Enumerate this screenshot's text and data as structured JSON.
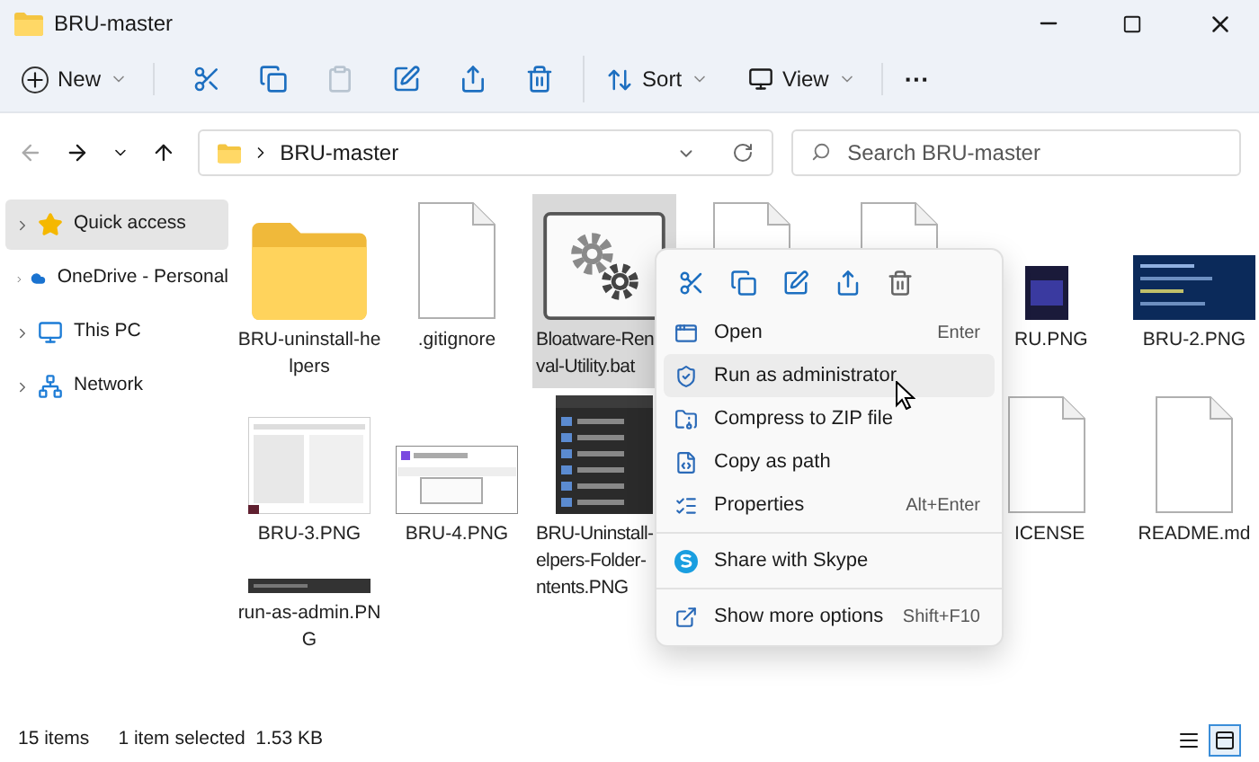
{
  "window": {
    "title": "BRU-master"
  },
  "toolbar": {
    "new_label": "New",
    "sort_label": "Sort",
    "view_label": "View",
    "more": "···"
  },
  "address": {
    "path": "BRU-master"
  },
  "search": {
    "placeholder": "Search BRU-master"
  },
  "sidebar": {
    "items": [
      {
        "label": "Quick access",
        "selected": true
      },
      {
        "label": "OneDrive - Personal",
        "selected": false
      },
      {
        "label": "This PC",
        "selected": false
      },
      {
        "label": "Network",
        "selected": false
      }
    ]
  },
  "rows": [
    [
      {
        "kind": "folder",
        "lines": [
          "BRU-uninstall-he",
          "lpers"
        ],
        "selected": false
      },
      {
        "kind": "file",
        "lines": [
          ".gitignore"
        ],
        "selected": false
      },
      {
        "kind": "gear",
        "lines": [
          "Bloatware-Ren",
          "val-Utility.bat"
        ],
        "selected": true
      },
      {
        "kind": "file-top"
      },
      {
        "kind": "file-top"
      },
      {
        "kind": "bru",
        "lines": [
          "RU.PNG"
        ],
        "selected": false
      },
      {
        "kind": "screen-blue",
        "lines": [
          "BRU-2.PNG"
        ],
        "selected": false
      }
    ],
    [
      {
        "kind": "screen-white",
        "lines": [
          "BRU-3.PNG"
        ],
        "selected": false
      },
      {
        "kind": "screen-dialog",
        "lines": [
          "BRU-4.PNG"
        ],
        "selected": false
      },
      {
        "kind": "screen-dark",
        "lines": [
          "BRU-Uninstall-",
          "elpers-Folder-",
          "ntents.PNG"
        ],
        "selected": false
      },
      {
        "kind": "hidden"
      },
      {
        "kind": "hidden"
      },
      {
        "kind": "file",
        "lines": [
          "ICENSE"
        ],
        "selected": false
      },
      {
        "kind": "file",
        "lines": [
          "README.md"
        ],
        "selected": false
      }
    ],
    [
      {
        "kind": "strip",
        "lines": [
          "run-as-admin.PN",
          "G"
        ],
        "selected": false
      }
    ]
  ],
  "context_menu": {
    "items": [
      {
        "kind": "command",
        "label": "Open",
        "shortcut": "Enter",
        "selected": false
      },
      {
        "kind": "command",
        "label": "Run as administrator",
        "selected": true
      },
      {
        "kind": "command",
        "label": "Compress to ZIP file",
        "selected": false
      },
      {
        "kind": "command",
        "label": "Copy as path",
        "selected": false
      },
      {
        "kind": "command",
        "label": "Properties",
        "shortcut": "Alt+Enter",
        "selected": false
      },
      {
        "kind": "separator"
      },
      {
        "kind": "command",
        "label": "Share with Skype",
        "selected": false
      },
      {
        "kind": "separator"
      },
      {
        "kind": "command",
        "label": "Show more options",
        "shortcut": "Shift+F10",
        "selected": false
      }
    ]
  },
  "status_bar": {
    "count": "15 items",
    "selection": "1 item selected  1.53 KB"
  },
  "view_buttons": [
    {
      "kind": "details",
      "selected": false
    },
    {
      "kind": "tiles",
      "selected": true
    }
  ]
}
